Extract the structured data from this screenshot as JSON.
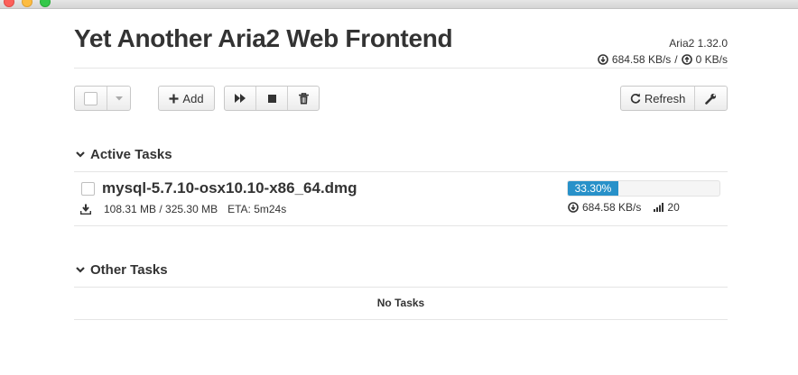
{
  "header": {
    "title": "Yet Another Aria2 Web Frontend",
    "version": "Aria2 1.32.0",
    "download_speed": "684.58 KB/s",
    "separator": "/",
    "upload_speed": "0 KB/s"
  },
  "toolbar": {
    "add_label": "Add",
    "refresh_label": "Refresh"
  },
  "active_section": {
    "title": "Active Tasks",
    "tasks": [
      {
        "name": "mysql-5.7.10-osx10.10-x86_64.dmg",
        "size": "108.31 MB / 325.30 MB",
        "eta": "ETA: 5m24s",
        "progress_percent": 33.3,
        "progress_label": "33.30%",
        "speed": "684.58 KB/s",
        "connections": "20"
      }
    ]
  },
  "other_section": {
    "title": "Other Tasks",
    "empty_text": "No Tasks"
  },
  "colors": {
    "progress": "#2891c9"
  },
  "icons": [
    "download-speed-icon",
    "upload-speed-icon",
    "plus-icon",
    "play-icon",
    "stop-icon",
    "trash-icon",
    "refresh-icon",
    "wrench-icon",
    "chevron-down-icon",
    "download-icon",
    "signal-icon",
    "caret-down-icon"
  ]
}
